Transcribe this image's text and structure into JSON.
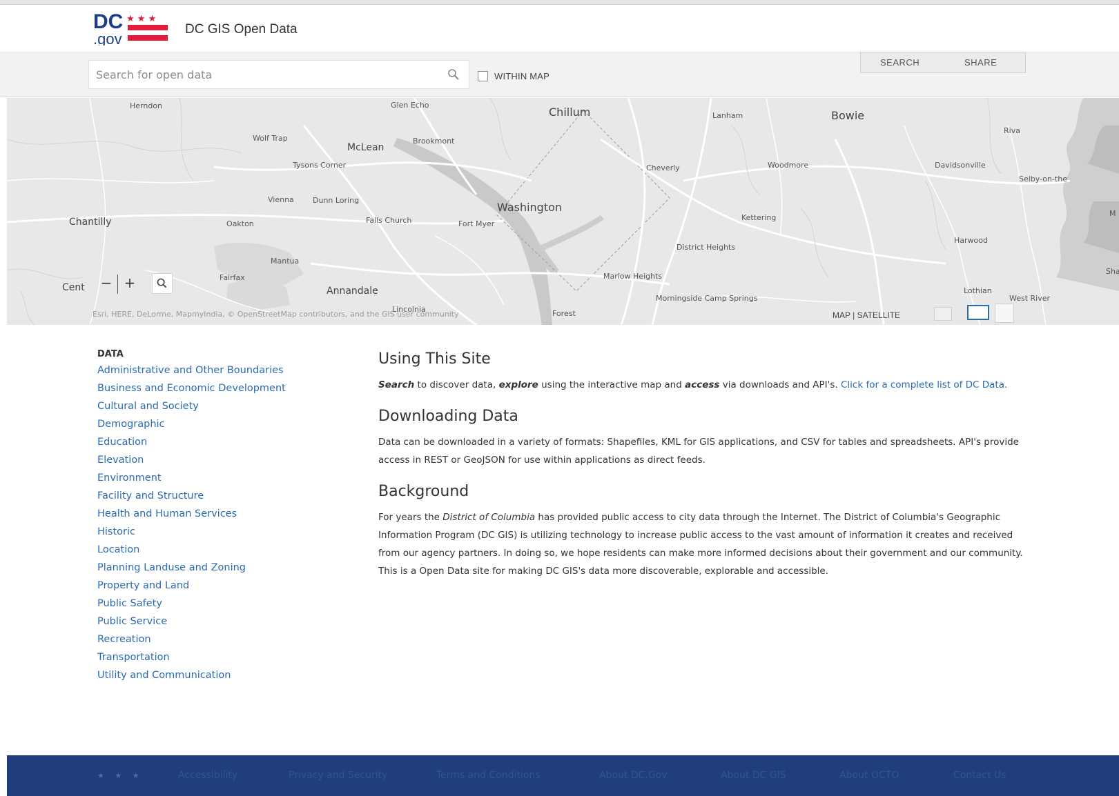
{
  "header": {
    "logo_text_top": "DC",
    "logo_text_bottom": ".gov",
    "site_title": "DC GIS Open Data",
    "brand_red": "#e21c3d",
    "brand_blue": "#1b3d8c"
  },
  "search": {
    "placeholder": "Search for open data",
    "within_map_label": "WITHIN MAP",
    "search_tab": "SEARCH",
    "share_tab": "SHARE"
  },
  "map": {
    "places": {
      "herndon": "Herndon",
      "glen_echo": "Glen Echo",
      "chillum": "Chillum",
      "lanham": "Lanham",
      "bowie": "Bowie",
      "riva": "Riva",
      "wolf_trap": "Wolf Trap",
      "mclean": "McLean",
      "brookmont": "Brookmont",
      "tysons_corner": "Tysons Corner",
      "cheverly": "Cheverly",
      "woodmore": "Woodmore",
      "davidsonville": "Davidsonville",
      "selby": "Selby-on-the",
      "vienna": "Vienna",
      "dunn_loring": "Dunn Loring",
      "washington": "Washington",
      "chantilly": "Chantilly",
      "oakton": "Oakton",
      "falls_church": "Falls Church",
      "fort_myer": "Fort Myer",
      "kettering": "Kettering",
      "m_partial": "M",
      "harwood": "Harwood",
      "district_heights": "District Heights",
      "mantua": "Mantua",
      "fairfax": "Fairfax",
      "annandale": "Annandale",
      "marlow_heights": "Marlow Heights",
      "morningside": "Morningside Camp Springs",
      "lothian": "Lothian",
      "west_river": "West River",
      "sha_partial": "Sha Sic",
      "lincolnia": "Lincolnia",
      "forest": "Forest"
    },
    "cent_label": "Cent",
    "zoom_out": "−",
    "zoom_in": "+",
    "attribution": "Esri, HERE, DeLorme, MapmyIndia, © OpenStreetMap contributors, and the GIS user community",
    "basemap_toggle": "MAP | SATELLITE"
  },
  "sidebar": {
    "heading": "DATA",
    "categories": [
      "Administrative and Other Boundaries",
      "Business and Economic Development",
      "Cultural and Society",
      "Demographic",
      "Education",
      "Elevation",
      "Environment",
      "Facility and Structure",
      "Health and Human Services",
      "Historic",
      "Location",
      "Planning Landuse and Zoning",
      "Property and Land",
      "Public Safety",
      "Public Service",
      "Recreation",
      "Transportation",
      "Utility and Communication"
    ]
  },
  "content": {
    "using": {
      "title": "Using This Site",
      "search_word": "Search",
      "text_1": " to discover data, ",
      "explore_word": "explore",
      "text_2": " using the interactive map and ",
      "access_word": "access",
      "text_3": " via downloads and API's. ",
      "link": "Click for a complete list of DC Data."
    },
    "downloading": {
      "title": "Downloading Data",
      "body": "Data can be downloaded in a variety of formats: Shapefiles, KML for GIS applications, and CSV for tables and spreadsheets. API's provide access in REST or GeoJSON for use within applications as direct feeds."
    },
    "background": {
      "title": "Background",
      "text_1": "For years the ",
      "dc_italic": "District of Columbia",
      "text_2": " has provided public access to city data through the Internet. The District of Columbia's Geographic Information Program (DC GIS) is utilizing technology to increase public access to the vast amount of information it creates and received from our agency partners. In doing so, we hope residents can make more informed decisions about their government and our community. This is a Open Data site for making DC GIS's data more discoverable, explorable and accessible."
    }
  },
  "footer": {
    "stars": "★ ★ ★",
    "links": {
      "accessibility": "Accessibility",
      "privacy": "Privacy and Security",
      "terms": "Terms and Conditions",
      "about_dcgov": "About DC.Gov",
      "about_dcgis": "About DC GIS",
      "about_octo": "About OCTO",
      "contact": "Contact Us"
    }
  }
}
